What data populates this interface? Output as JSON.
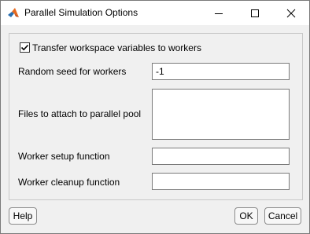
{
  "window": {
    "title": "Parallel Simulation Options"
  },
  "options": {
    "transfer_checkbox": {
      "label": "Transfer workspace variables to workers",
      "checked": true
    },
    "random_seed": {
      "label": "Random seed for workers",
      "value": "-1"
    },
    "files_to_attach": {
      "label": "Files to attach to parallel pool",
      "value": ""
    },
    "worker_setup": {
      "label": "Worker setup function",
      "value": ""
    },
    "worker_cleanup": {
      "label": "Worker cleanup function",
      "value": ""
    }
  },
  "buttons": {
    "help": "Help",
    "ok": "OK",
    "cancel": "Cancel"
  },
  "icons": {
    "app": "matlab-app-icon",
    "minimize": "minimize-icon",
    "maximize": "maximize-icon",
    "close": "close-icon",
    "check": "checkmark-icon"
  },
  "colors": {
    "window_bg": "#f0f0f0",
    "titlebar_bg": "#ffffff",
    "field_border": "#7a7a7a"
  }
}
